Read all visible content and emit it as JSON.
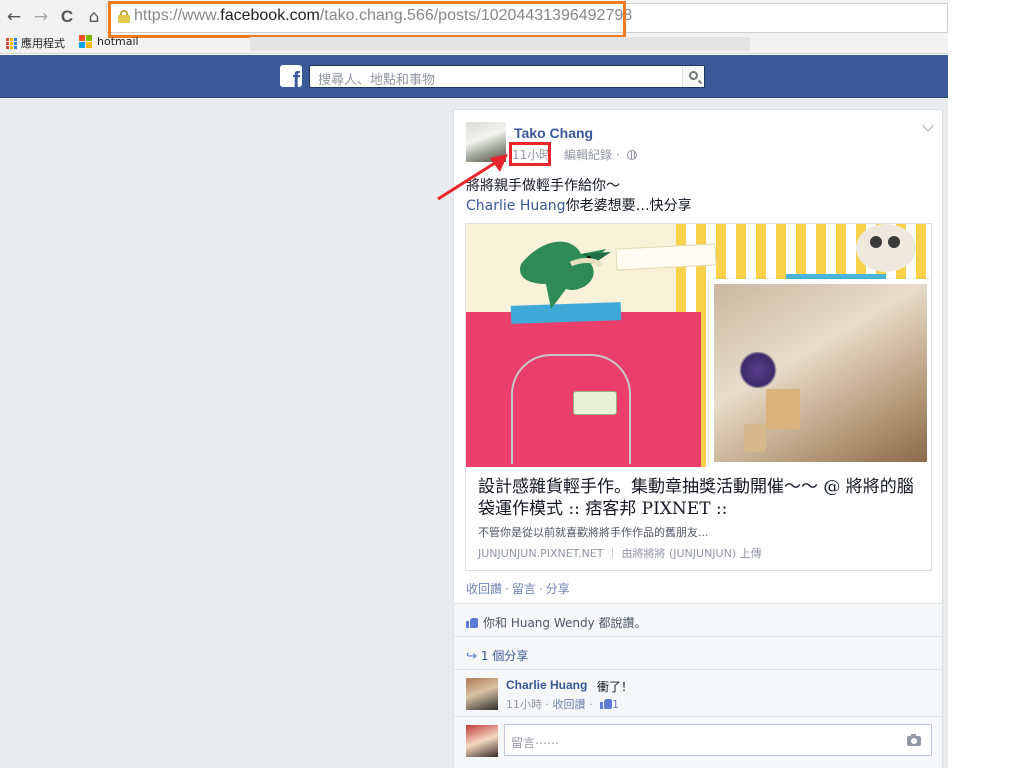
{
  "browser": {
    "back_icon": "←",
    "forward_icon": "→",
    "reload_icon": "C",
    "home_icon": "⌂",
    "url_prefix": "https://www.",
    "url_domain": "facebook.com",
    "url_path": "/tako.chang.566/posts/10204431396492798",
    "bookmarks": [
      {
        "label": "應用程式",
        "icon": "apps-icon"
      },
      {
        "label": "hotmail",
        "icon": "windows-logo-icon"
      }
    ],
    "highlight_color": "#f07a1f"
  },
  "fb": {
    "logo_letter": "f",
    "search_placeholder": "搜尋人、地點和事物",
    "brand_color": "#3b5998"
  },
  "post": {
    "author": "Tako Chang",
    "time": "11小時",
    "edit_history": "編輯紀錄",
    "dot": "·",
    "text_line1": "將將親手做輕手作給你～",
    "mention": "Charlie Huang",
    "text_line2_rest": "你老婆想要…快分享",
    "annotation_color": "#e8262c"
  },
  "preview": {
    "title": "設計感雜貨輕手作。集動章抽獎活動開催～～ @ 將將的腦袋運作模式 :: 痞客邦 PIXNET ::",
    "description": "不管你是從以前就喜歡將將手作作品的舊朋友...",
    "source": "JUNJUNJUN.PIXNET.NET ｜ 由將將將 (JUNJUNJUN) 上傳"
  },
  "actions": {
    "like": "收回讚",
    "comment": "留言",
    "share": "分享"
  },
  "ufi": {
    "likes_text": "你和 Huang Wendy 都說讚。",
    "shares_text": "1 個分享",
    "comment": {
      "author": "Charlie Huang",
      "text": "衝了！",
      "time": "11小時",
      "unlike": "收回讚",
      "like_count": "1"
    },
    "write_placeholder": "留言⋯⋯"
  }
}
